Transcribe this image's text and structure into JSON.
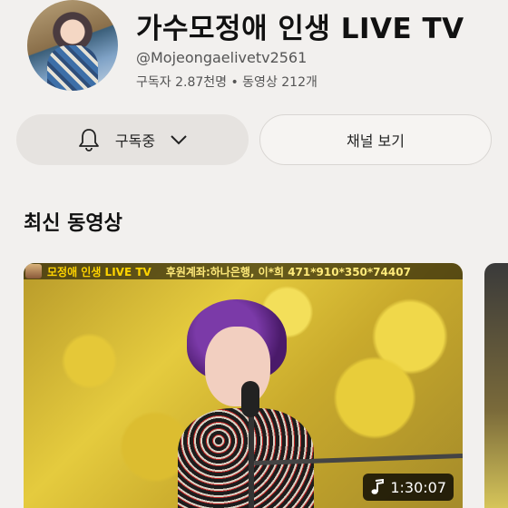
{
  "channel": {
    "title": "가수모정애 인생 LIVE TV",
    "handle": "@Mojeongaelivetv2561",
    "stats": "구독자 2.87천명 • 동영상 212개"
  },
  "buttons": {
    "subscribe_label": "구독중",
    "channel_view_label": "채널 보기"
  },
  "section": {
    "latest_title": "최신 동영상"
  },
  "video": {
    "overlay_title": "모정애 인생 LIVE TV",
    "overlay_donation": "후원계좌:하나은행, 이*희 471*910*350*74407",
    "duration": "1:30:07"
  },
  "icons": {
    "bell": "bell-icon",
    "chevron": "chevron-down-icon",
    "music": "music-note-icon"
  }
}
